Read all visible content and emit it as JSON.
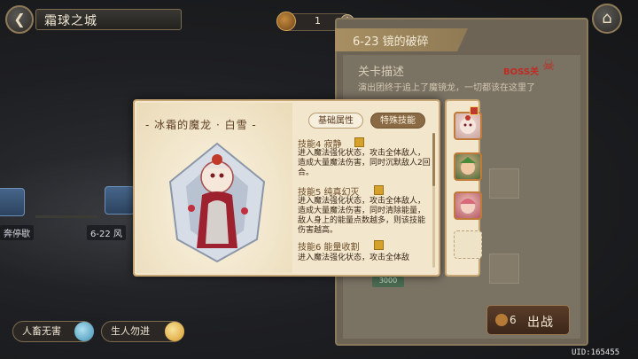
{
  "top_bar": {
    "back_icon": "back-arrow-icon",
    "title": "霜球之城",
    "resource_value": "1",
    "resource_plus": "+",
    "home_icon": "home-icon"
  },
  "stage_panel": {
    "stage_name": "6-23 镜的破碎",
    "description_title": "关卡描述",
    "boss_tag": "BOSS关",
    "description": "演出团终于追上了魔镜龙，一切都该在这里了",
    "cost_badge": "3000",
    "battle_cost": "6",
    "battle_label": "出战"
  },
  "map_nodes": [
    {
      "label": "6-22 风"
    },
    {
      "label": "奔停歇"
    }
  ],
  "character_popup": {
    "name": "- 冰霜的魔龙 · 白雪 -",
    "tabs": [
      {
        "label": "基础属性",
        "active": false
      },
      {
        "label": "特殊技能",
        "active": true
      }
    ],
    "skills": [
      {
        "title": "技能4  寂静",
        "desc": "进入魔法强化状态，攻击全体敌人，造成大量魔法伤害，同时沉默敌人2回合。"
      },
      {
        "title": "技能5  纯真幻灭",
        "desc": "进入魔法强化状态，攻击全体敌人，造成大量魔法伤害，同时清除能量，敌人身上的能量点数越多，则该技能伤害越高。"
      },
      {
        "title": "技能6  能量收割",
        "desc": "进入魔法强化状态，攻击全体敌"
      }
    ]
  },
  "team_slots": [
    {
      "state": "filled",
      "icon": "character-snow-avatar-icon"
    },
    {
      "state": "filled",
      "icon": "character-green-avatar-icon"
    },
    {
      "state": "filled",
      "icon": "character-pink-avatar-icon"
    },
    {
      "state": "empty"
    }
  ],
  "bottom_bar": {
    "toggle_1": "人畜无害",
    "toggle_2": "生人勿进",
    "uid": "UID:165455"
  },
  "colors": {
    "popup_bg": "#f2e6cc",
    "popup_border": "#c7a673",
    "accent_brown": "#8a6a44",
    "boss_red": "#c22a22"
  }
}
